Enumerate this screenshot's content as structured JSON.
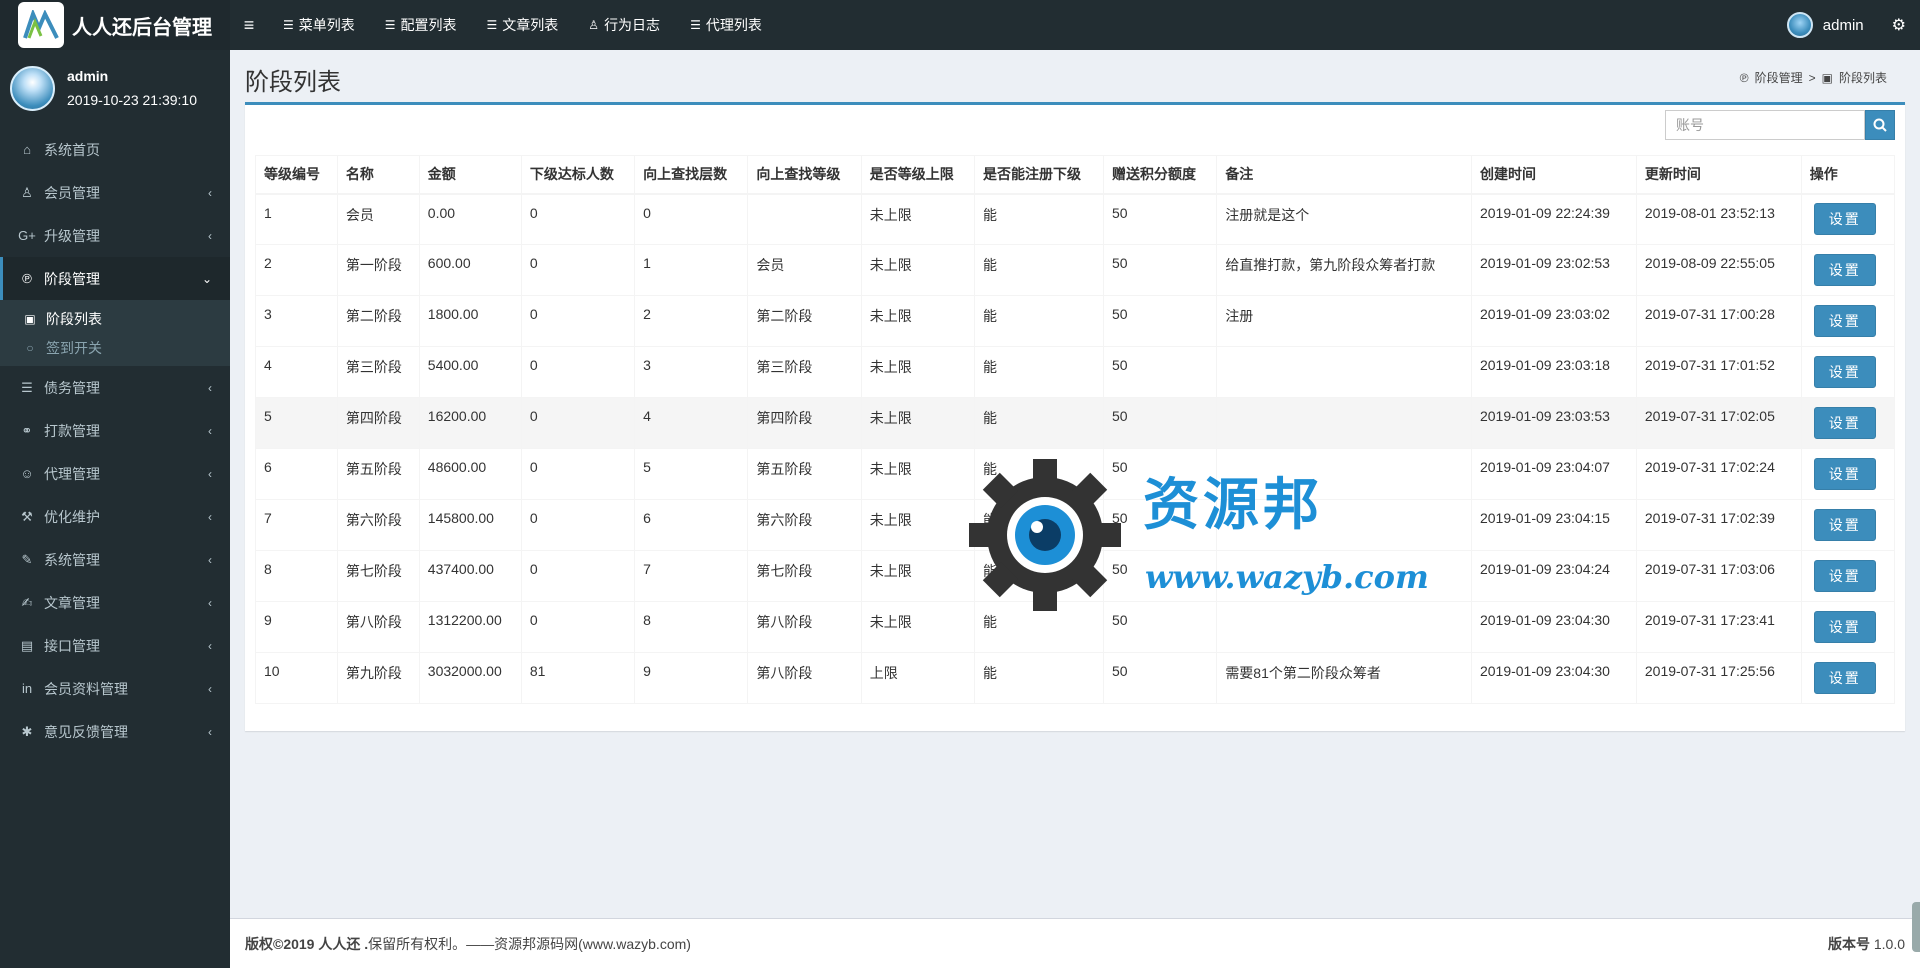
{
  "header": {
    "app_title": "人人还后台管理",
    "nav": [
      {
        "label": "菜单列表",
        "icon": "list-icon"
      },
      {
        "label": "配置列表",
        "icon": "list-icon"
      },
      {
        "label": "文章列表",
        "icon": "list-icon"
      },
      {
        "label": "行为日志",
        "icon": "user-icon"
      },
      {
        "label": "代理列表",
        "icon": "list-icon"
      }
    ],
    "user": "admin"
  },
  "sidebar": {
    "user_name": "admin",
    "login_time": "2019-10-23 21:39:10",
    "items": [
      {
        "label": "系统首页"
      },
      {
        "label": "会员管理"
      },
      {
        "label": "升级管理"
      },
      {
        "label": "阶段管理"
      },
      {
        "label": "债务管理"
      },
      {
        "label": "打款管理"
      },
      {
        "label": "代理管理"
      },
      {
        "label": "优化维护"
      },
      {
        "label": "系统管理"
      },
      {
        "label": "文章管理"
      },
      {
        "label": "接口管理"
      },
      {
        "label": "会员资料管理"
      },
      {
        "label": "意见反馈管理"
      }
    ],
    "sub_items": [
      {
        "label": "阶段列表"
      },
      {
        "label": "签到开关"
      }
    ]
  },
  "page": {
    "title": "阶段列表",
    "breadcrumb_parent": "阶段管理",
    "breadcrumb_sep": ">",
    "breadcrumb_current": "阶段列表",
    "search_placeholder": "账号"
  },
  "table": {
    "columns": [
      "等级编号",
      "名称",
      "金额",
      "下级达标人数",
      "向上查找层数",
      "向上查找等级",
      "是否等级上限",
      "是否能注册下级",
      "赠送积分额度",
      "备注",
      "创建时间",
      "更新时间",
      "操作"
    ],
    "rows": [
      [
        "1",
        "会员",
        "0.00",
        "0",
        "0",
        "",
        "未上限",
        "能",
        "50",
        "注册就是这个",
        "2019-01-09 22:24:39",
        "2019-08-01 23:52:13"
      ],
      [
        "2",
        "第一阶段",
        "600.00",
        "0",
        "1",
        "会员",
        "未上限",
        "能",
        "50",
        "给直推打款，第九阶段众筹者打款",
        "2019-01-09 23:02:53",
        "2019-08-09 22:55:05"
      ],
      [
        "3",
        "第二阶段",
        "1800.00",
        "0",
        "2",
        "第二阶段",
        "未上限",
        "能",
        "50",
        "注册",
        "2019-01-09 23:03:02",
        "2019-07-31 17:00:28"
      ],
      [
        "4",
        "第三阶段",
        "5400.00",
        "0",
        "3",
        "第三阶段",
        "未上限",
        "能",
        "50",
        "",
        "2019-01-09 23:03:18",
        "2019-07-31 17:01:52"
      ],
      [
        "5",
        "第四阶段",
        "16200.00",
        "0",
        "4",
        "第四阶段",
        "未上限",
        "能",
        "50",
        "",
        "2019-01-09 23:03:53",
        "2019-07-31 17:02:05"
      ],
      [
        "6",
        "第五阶段",
        "48600.00",
        "0",
        "5",
        "第五阶段",
        "未上限",
        "能",
        "50",
        "",
        "2019-01-09 23:04:07",
        "2019-07-31 17:02:24"
      ],
      [
        "7",
        "第六阶段",
        "145800.00",
        "0",
        "6",
        "第六阶段",
        "未上限",
        "能",
        "50",
        "",
        "2019-01-09 23:04:15",
        "2019-07-31 17:02:39"
      ],
      [
        "8",
        "第七阶段",
        "437400.00",
        "0",
        "7",
        "第七阶段",
        "未上限",
        "能",
        "50",
        "",
        "2019-01-09 23:04:24",
        "2019-07-31 17:03:06"
      ],
      [
        "9",
        "第八阶段",
        "1312200.00",
        "0",
        "8",
        "第八阶段",
        "未上限",
        "能",
        "50",
        "",
        "2019-01-09 23:04:30",
        "2019-07-31 17:23:41"
      ],
      [
        "10",
        "第九阶段",
        "3032000.00",
        "81",
        "9",
        "第八阶段",
        "上限",
        "能",
        "50",
        "需要81个第二阶段众筹者",
        "2019-01-09 23:04:30",
        "2019-07-31 17:25:56"
      ]
    ],
    "action_label": "设置",
    "highlight_row": 4
  },
  "watermark": {
    "title": "资源邦",
    "url": "www.wazyb.com"
  },
  "footer": {
    "copyright_bold": "版权©2019 人人还 .",
    "copyright_rest": " 保留所有权利。——资源邦源码网(www.wazyb.com)",
    "version_label": "版本号",
    "version_value": " 1.0.0"
  },
  "colors": {
    "accent": "#3c8dbc",
    "sidebar_bg": "#222d32",
    "watermark": "#1d8fd6"
  }
}
